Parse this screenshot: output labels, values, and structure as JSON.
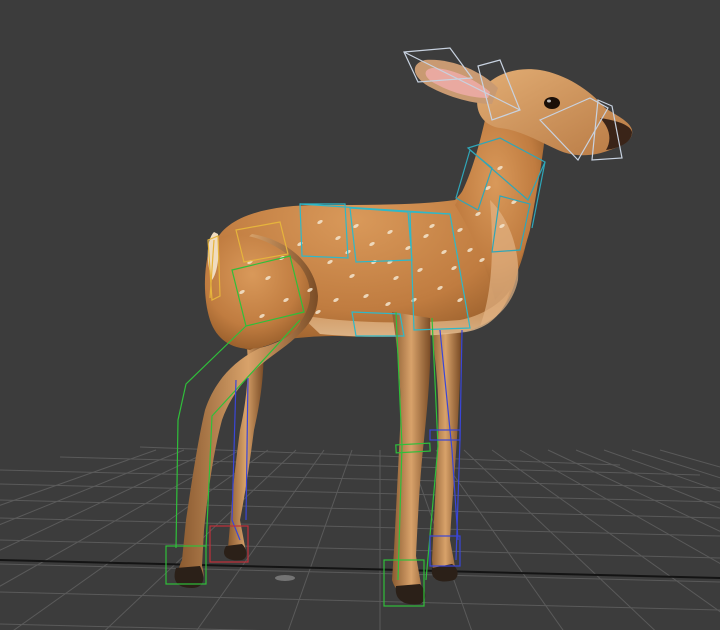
{
  "viewport": {
    "background": "#3c3c3c",
    "grid_color": "#5a5a5a",
    "grid_center_line_color": "#111111",
    "model": "fawn",
    "model_colors": {
      "coat": "#c8874a",
      "coat_dark": "#8a5424",
      "belly": "#e3b98a",
      "spots": "#f4e6cf",
      "hoof": "#2b2018",
      "ear_inner": "#e9a9a0",
      "eye": "#1a0f08"
    },
    "rig_colors": {
      "neck_spine": "#2fa6b8",
      "torso": "#2fb8c8",
      "hip": "#e6b43c",
      "left_legs": "#2fbf3a",
      "right_legs": "#3a46d8",
      "head": "#c8d2e0",
      "foot_ik": "#c0303a"
    }
  }
}
